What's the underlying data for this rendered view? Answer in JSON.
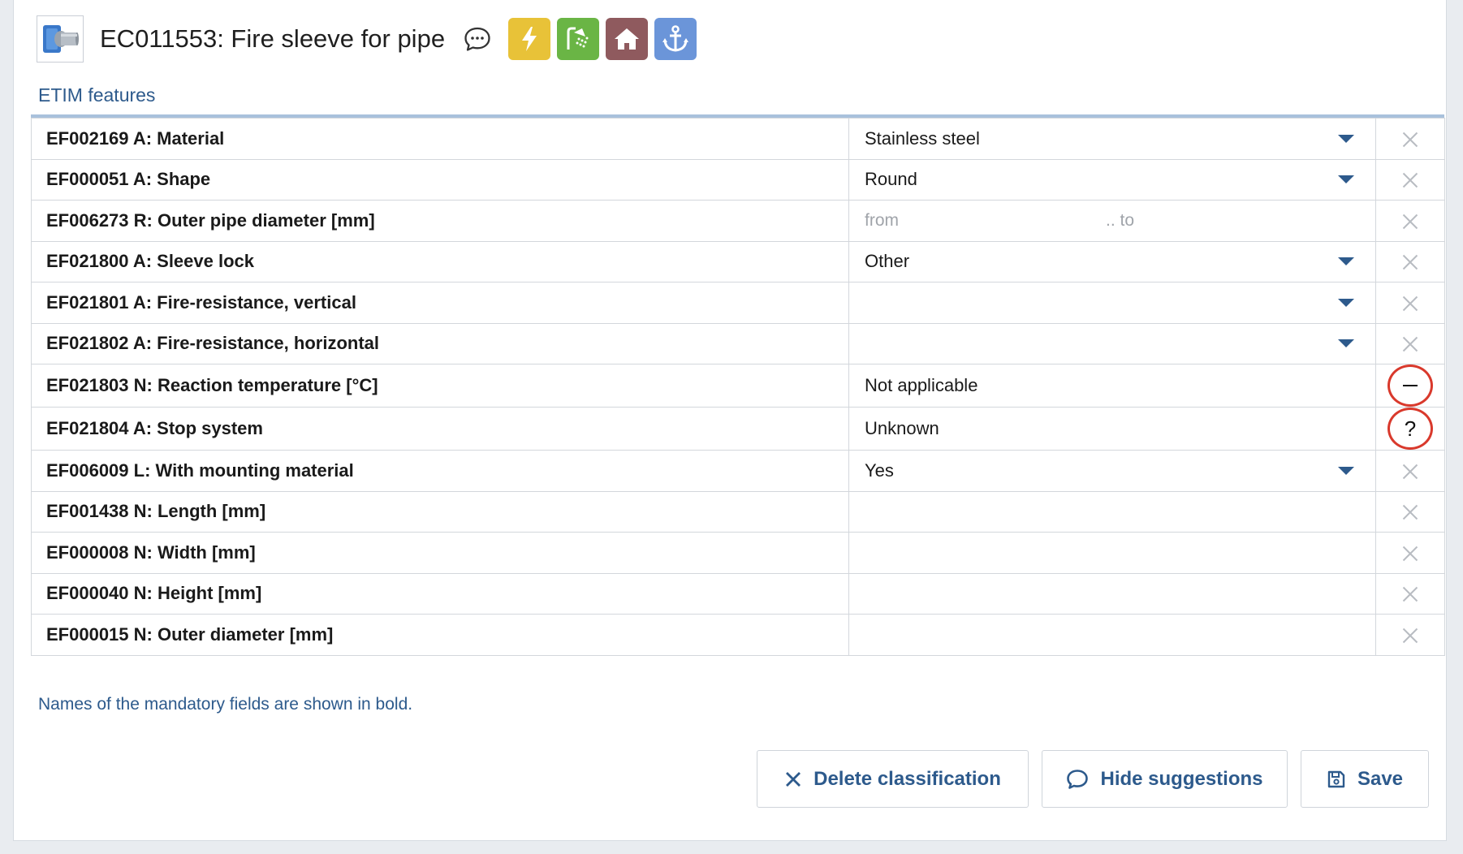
{
  "header": {
    "title": "EC011553: Fire sleeve for pipe",
    "thumbnail_icon": "pipe-sleeve-icon",
    "comment_icon": "comment-icon",
    "badges": [
      {
        "icon": "lightning-icon",
        "color": "#e8c238"
      },
      {
        "icon": "shower-icon",
        "color": "#6ab545"
      },
      {
        "icon": "house-icon",
        "color": "#8f5a5e"
      },
      {
        "icon": "anchor-icon",
        "color": "#6b95d9"
      }
    ]
  },
  "section": {
    "title": "ETIM features"
  },
  "features": [
    {
      "name": "EF002169 A: Material",
      "value": "Stainless steel",
      "control": "dropdown",
      "action": "clear"
    },
    {
      "name": "EF000051 A: Shape",
      "value": "Round",
      "control": "dropdown",
      "action": "clear"
    },
    {
      "name": "EF006273 R: Outer pipe diameter [mm]",
      "control": "range",
      "from_placeholder": "from",
      "to_placeholder": ".. to",
      "action": "clear"
    },
    {
      "name": "EF021800 A: Sleeve lock",
      "value": "Other",
      "control": "dropdown",
      "action": "clear"
    },
    {
      "name": "EF021801 A: Fire-resistance, vertical",
      "value": "",
      "control": "dropdown",
      "action": "clear"
    },
    {
      "name": "EF021802 A: Fire-resistance, horizontal",
      "value": "",
      "control": "dropdown",
      "action": "clear"
    },
    {
      "name": "EF021803 N: Reaction temperature [°C]",
      "value": "Not applicable",
      "control": "text",
      "action": "not-applicable"
    },
    {
      "name": "EF021804 A: Stop system",
      "value": "Unknown",
      "control": "text",
      "action": "unknown"
    },
    {
      "name": "EF006009 L: With mounting material",
      "value": "Yes",
      "control": "dropdown",
      "action": "clear"
    },
    {
      "name": "EF001438 N: Length [mm]",
      "value": "",
      "control": "text",
      "action": "clear"
    },
    {
      "name": "EF000008 N: Width [mm]",
      "value": "",
      "control": "text",
      "action": "clear"
    },
    {
      "name": "EF000040 N: Height [mm]",
      "value": "",
      "control": "text",
      "action": "clear"
    },
    {
      "name": "EF000015 N: Outer diameter [mm]",
      "value": "",
      "control": "text",
      "action": "clear"
    }
  ],
  "unknown_symbol": "?",
  "note": "Names of the mandatory fields are shown in bold.",
  "buttons": {
    "delete_label": "Delete classification",
    "hide_label": "Hide suggestions",
    "save_label": "Save"
  },
  "colors": {
    "accent": "#2d5a8c",
    "highlight_circle": "#d9392c",
    "table_top_border": "#a9c1dc"
  }
}
